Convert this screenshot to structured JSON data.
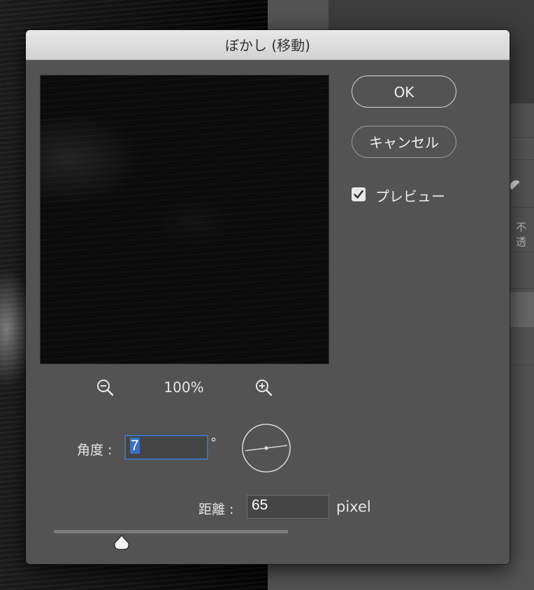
{
  "dialog": {
    "title": "ぼかし (移動)",
    "ok_label": "OK",
    "cancel_label": "キャンセル",
    "preview_label": "プレビュー",
    "preview_checked": true
  },
  "zoom": {
    "level": "100%",
    "zoom_out_icon": "zoom-out-icon",
    "zoom_in_icon": "zoom-in-icon"
  },
  "angle": {
    "label": "角度 :",
    "value": "7",
    "unit": "°",
    "dial_icon": "angle-dial-icon"
  },
  "distance": {
    "label": "距離 :",
    "value": "65",
    "unit": "pixel",
    "slider_fraction": 0.29
  },
  "background": {
    "partial_text": "不透"
  },
  "colors": {
    "accent": "#3a7bd5",
    "dialog_bg": "#535353",
    "titlebar": "#dcdcdc"
  }
}
